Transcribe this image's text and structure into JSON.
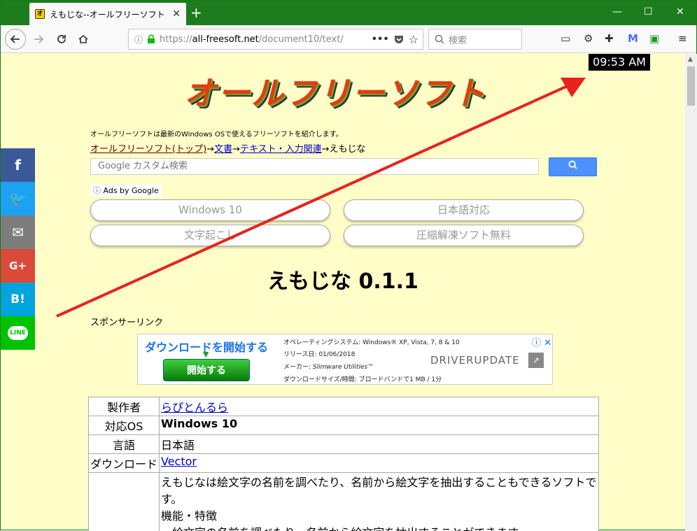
{
  "browser": {
    "tab_title": "えもじな--オールフリーソフト　Windo",
    "favicon_text": "オ",
    "tab_close": "✕",
    "new_tab": "+",
    "url_scheme": "https://",
    "url_host": "all-freesoft.net",
    "url_path": "/document10/text/",
    "search_placeholder": "検索",
    "window_controls": {
      "minimize": "—",
      "maximize": "☐",
      "close": "✕"
    }
  },
  "overlay": {
    "clock": "09:53 AM",
    "arrow_color": "#e8221c"
  },
  "site": {
    "logo_text": "オールフリーソフト",
    "tagline": "オールフリーソフトは最新のWindows OSで使えるフリーソフトを紹介します。",
    "breadcrumb": {
      "home": "オールフリーソフト(トップ)",
      "sep": "→",
      "doc": "文書",
      "text_input": "テキスト・入力関連",
      "current": "えもじな"
    },
    "search_placeholder": "Google カスタム検索",
    "search_button_icon": "search-icon",
    "ads_label": "Ads by Google",
    "ads_icon": "ⓘ",
    "pills": [
      "Windows 10",
      "日本語対応",
      "文字起こし",
      "圧縮解凍ソフト無料"
    ],
    "title": "えもじな 0.1.1",
    "sponsor_label": "スポンサーリンク"
  },
  "ad": {
    "headline": "ダウンロードを開始する",
    "arrow": "▼",
    "start_button": "開始する",
    "os": "オペレーティングシステム: Windows® XP, Vista, 7, 8 & 10",
    "release": "リリース日: 01/06/2018",
    "maker_label": "メーカー:",
    "maker_value": "Slimware Utilities™",
    "size": "ダウンロードサイズ/時間: ブロードバンドで1 MB / 1分",
    "brand": "DRIVERUPDATE",
    "brand_mark": "↗",
    "close": "ⓘ ✕"
  },
  "info_table": {
    "rows": [
      {
        "key": "製作者",
        "value": "らぴとんるら",
        "link": true
      },
      {
        "key": "対応OS",
        "value": "Windows 10",
        "bold": true
      },
      {
        "key": "言語",
        "value": "日本語"
      },
      {
        "key": "ダウンロード",
        "value": "Vector",
        "link": true
      }
    ],
    "description": "えもじなは絵文字の名前を調べたり、名前から絵文字を抽出することもできるソフトです。",
    "features_label": "機能・特徴",
    "feature_1": "・絵文字の名前を調べたり、名前から絵文字を抽出することができます。"
  },
  "social": [
    {
      "name": "facebook",
      "glyph": "f",
      "color": "#3b5998"
    },
    {
      "name": "twitter",
      "glyph": "🐦",
      "color": "#1da1f2"
    },
    {
      "name": "email",
      "glyph": "✉",
      "color": "#7d7d7d"
    },
    {
      "name": "googleplus",
      "glyph": "G+",
      "color": "#db4a39"
    },
    {
      "name": "hatena",
      "glyph": "B!",
      "color": "#00a4de"
    },
    {
      "name": "line",
      "glyph": "LINE",
      "color": "#00c300"
    }
  ]
}
